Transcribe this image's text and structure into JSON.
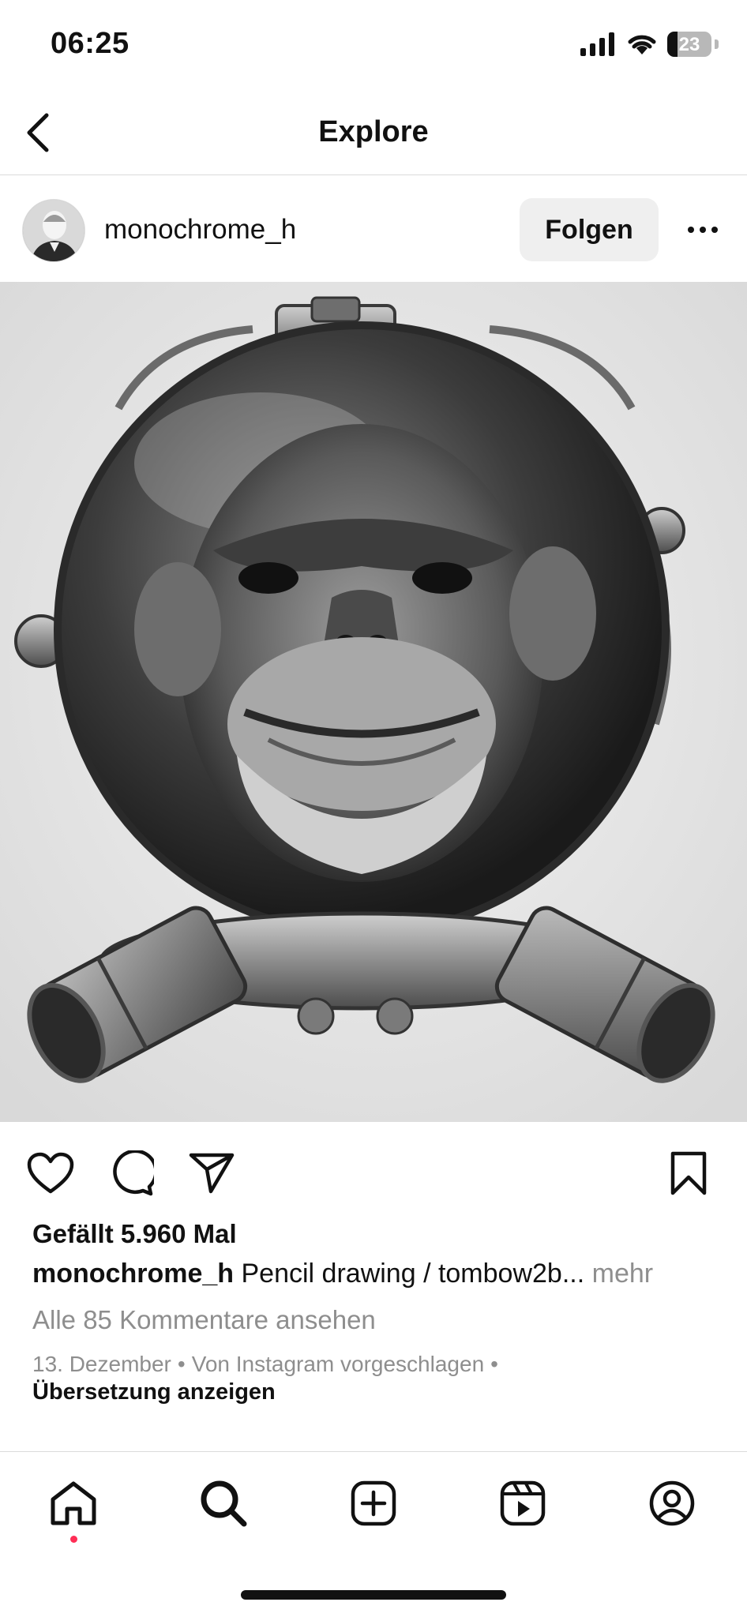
{
  "status_bar": {
    "time": "06:25",
    "battery_level": "23",
    "battery_fraction": 0.23
  },
  "nav": {
    "title": "Explore",
    "back_icon": "chevron-left-icon"
  },
  "post": {
    "username": "monochrome_h",
    "follow_label": "Folgen",
    "more_icon": "more-horizontal-icon",
    "image_description_icon": "pencil-drawing-image",
    "actions": {
      "like_icon": "heart-icon",
      "comment_icon": "comment-icon",
      "share_icon": "send-icon",
      "save_icon": "bookmark-icon"
    },
    "likes_text": "Gefällt 5.960 Mal",
    "caption_user": "monochrome_h",
    "caption_text": "Pencil drawing / tombow2b...",
    "caption_more": "mehr",
    "comments_link": "Alle 85 Kommentare ansehen",
    "date": "13. Dezember",
    "suggested": "Von Instagram vorgeschlagen",
    "separator": "•",
    "translate_link": "Übersetzung anzeigen"
  },
  "tab_bar": {
    "items": [
      {
        "icon": "home-icon",
        "active": true
      },
      {
        "icon": "search-icon",
        "active": false
      },
      {
        "icon": "create-icon",
        "active": false
      },
      {
        "icon": "reels-icon",
        "active": false
      },
      {
        "icon": "profile-icon",
        "active": false
      }
    ]
  },
  "colors": {
    "text": "#111111",
    "muted": "#8e8e8e",
    "button_bg": "#efefef",
    "notification_dot": "#ff2d55",
    "divider": "#dbdbdb"
  }
}
